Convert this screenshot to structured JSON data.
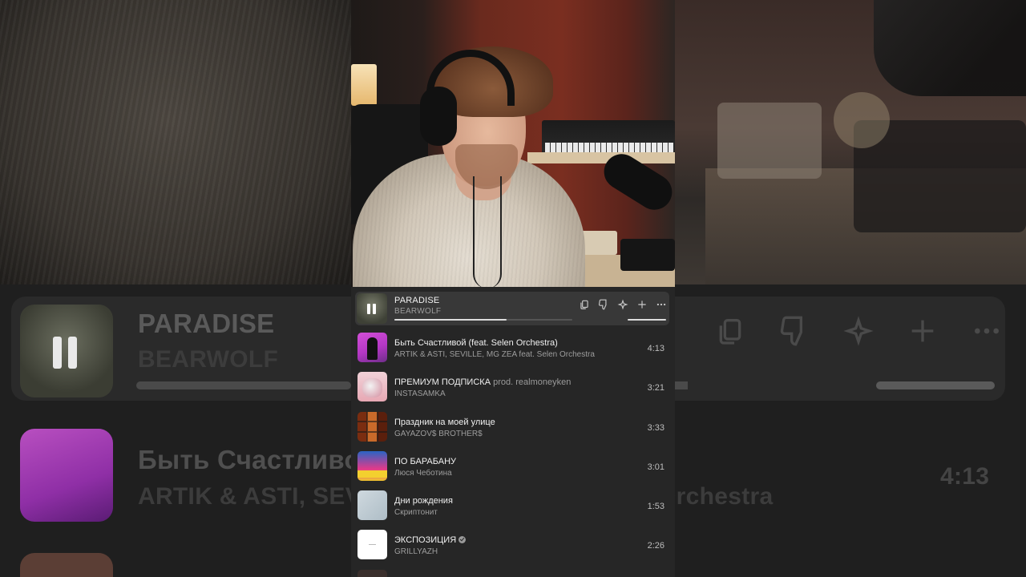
{
  "background": {
    "big_now_playing_title": "PARADISE",
    "big_now_playing_artist": "BEARWOLF",
    "big_track_title": "Быть Счастливой",
    "big_track_artist": "ARTIK & ASTI, SEV",
    "big_track_artist_tail": "Orchestra",
    "big_track_duration": "4:13"
  },
  "now_playing": {
    "title": "PARADISE",
    "artist": "BEARWOLF",
    "progress": 0.63,
    "actions": [
      {
        "icon": "copy-icon",
        "label": "Копировать"
      },
      {
        "icon": "dislike-icon",
        "label": "Не нравится"
      },
      {
        "icon": "sparkle-icon",
        "label": "Рекомендации"
      },
      {
        "icon": "plus-icon",
        "label": "Добавить"
      },
      {
        "icon": "more-icon",
        "label": "Ещё"
      }
    ]
  },
  "tracks": [
    {
      "title": "Быть Счастливой (feat. Selen Orchestra)",
      "prod": "",
      "artist": "ARTIK & ASTI, SEVILLE, MG ZEA feat. Selen Orchestra",
      "duration": "4:13",
      "verified": false
    },
    {
      "title": "ПРЕМИУМ ПОДПИСКА",
      "prod": "prod. realmoneyken",
      "artist": "INSTASAMKA",
      "duration": "3:21",
      "verified": false
    },
    {
      "title": "Праздник на моей улице",
      "prod": "",
      "artist": "GAYAZOV$ BROTHER$",
      "duration": "3:33",
      "verified": false
    },
    {
      "title": "ПО БАРАБАНУ",
      "prod": "",
      "artist": "Люся Чеботина",
      "duration": "3:01",
      "verified": false
    },
    {
      "title": "Дни рождения",
      "prod": "",
      "artist": "Скриптонит",
      "duration": "1:53",
      "verified": false
    },
    {
      "title": "ЭКСПОЗИЦИЯ",
      "prod": "",
      "artist": "GRILLYAZH",
      "duration": "2:26",
      "verified": true
    }
  ]
}
